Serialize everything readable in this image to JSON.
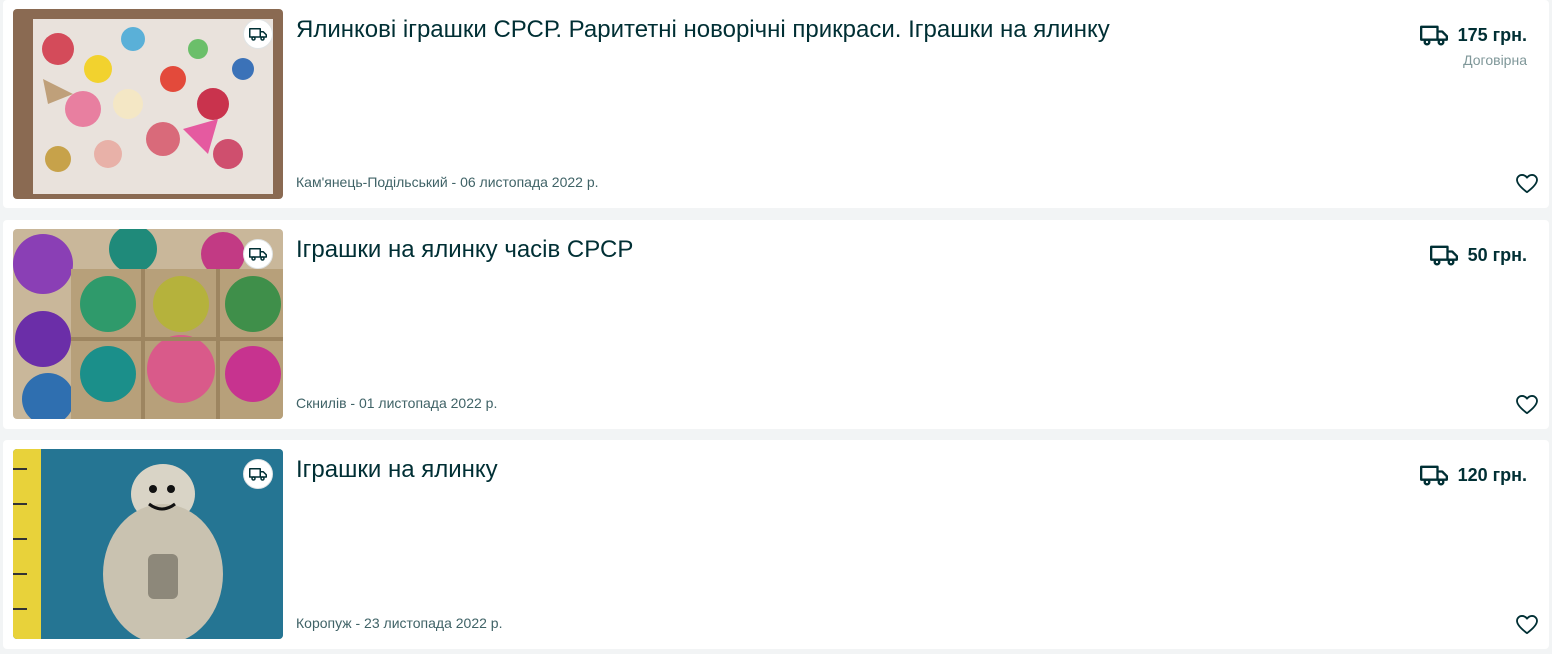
{
  "listings": [
    {
      "title": "Ялинкові іграшки СРСР. Раритетні новорічні прикраси. Іграшки на ялинку",
      "price": "175 грн.",
      "negotiable": "Договірна",
      "meta": "Кам'янець-Подільський - 06 листопада 2022 р.",
      "image_icon": "ornaments-photo",
      "delivery_icon": "truck-icon"
    },
    {
      "title": "Іграшки на ялинку часів СРСР",
      "price": "50 грн.",
      "negotiable": "",
      "meta": "Скнилів - 01 листопада 2022 р.",
      "image_icon": "ornament-box-photo",
      "delivery_icon": "truck-icon"
    },
    {
      "title": "Іграшки на ялинку",
      "price": "120 грн.",
      "negotiable": "",
      "meta": "Коропуж - 23 листопада 2022 р.",
      "image_icon": "snowman-ornament-photo",
      "delivery_icon": "truck-icon"
    }
  ],
  "colors": {
    "text": "#002f34",
    "muted": "#406367",
    "background": "#f2f4f5",
    "card": "#ffffff"
  }
}
